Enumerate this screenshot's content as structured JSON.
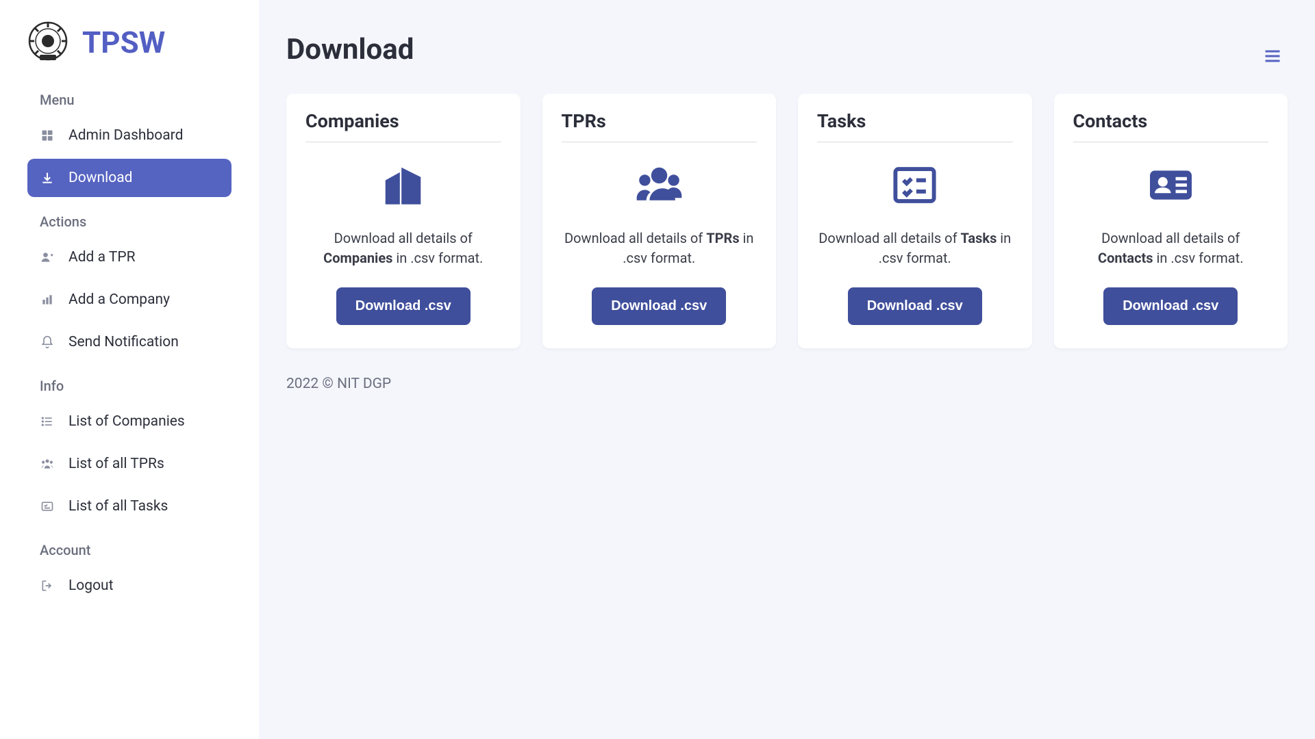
{
  "brand": {
    "name": "TPSW"
  },
  "sidebar": {
    "sections": {
      "menu": {
        "heading": "Menu",
        "items": [
          {
            "label": "Admin Dashboard"
          },
          {
            "label": "Download"
          }
        ]
      },
      "actions": {
        "heading": "Actions",
        "items": [
          {
            "label": "Add a TPR"
          },
          {
            "label": "Add a Company"
          },
          {
            "label": "Send Notification"
          }
        ]
      },
      "info": {
        "heading": "Info",
        "items": [
          {
            "label": "List of Companies"
          },
          {
            "label": "List of all TPRs"
          },
          {
            "label": "List of all Tasks"
          }
        ]
      },
      "account": {
        "heading": "Account",
        "items": [
          {
            "label": "Logout"
          }
        ]
      }
    }
  },
  "page": {
    "title": "Download"
  },
  "cards": [
    {
      "title": "Companies",
      "desc_pre": "Download all details of ",
      "desc_bold": "Companies",
      "desc_post": " in .csv format.",
      "button": "Download .csv"
    },
    {
      "title": "TPRs",
      "desc_pre": "Download all details of ",
      "desc_bold": "TPRs",
      "desc_post": " in .csv format.",
      "button": "Download .csv"
    },
    {
      "title": "Tasks",
      "desc_pre": "Download all details of ",
      "desc_bold": "Tasks",
      "desc_post": " in .csv format.",
      "button": "Download .csv"
    },
    {
      "title": "Contacts",
      "desc_pre": "Download all details of ",
      "desc_bold": "Contacts",
      "desc_post": " in .csv format.",
      "button": "Download .csv"
    }
  ],
  "footer": "2022 © NIT DGP"
}
